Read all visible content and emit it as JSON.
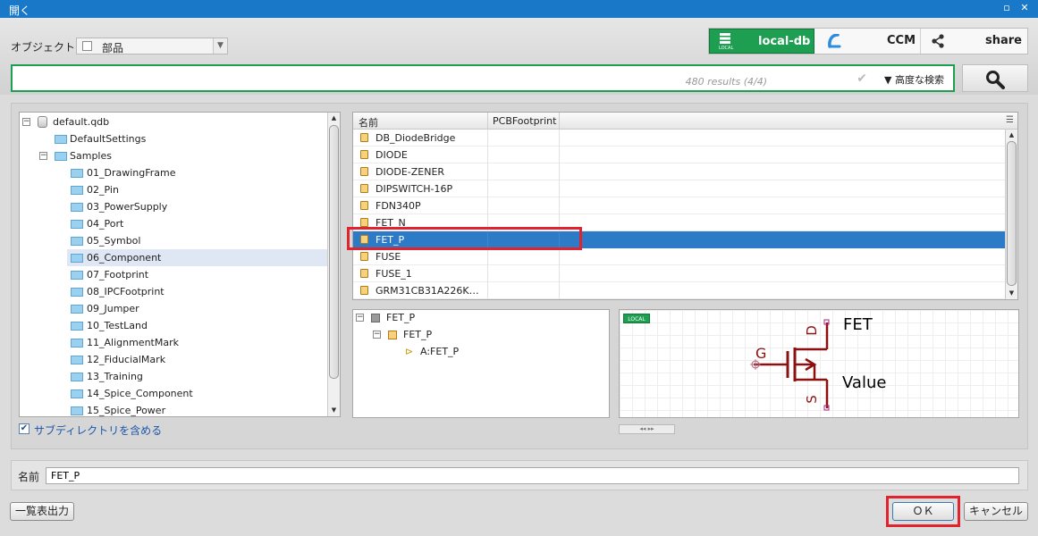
{
  "window": {
    "title": "開く",
    "buttons": [
      "▫",
      "✕"
    ]
  },
  "object": {
    "label": "オブジェクト",
    "selected": "部品"
  },
  "databases": [
    {
      "label": "local-db",
      "icon": "local-db-icon",
      "badge": "LOCAL",
      "active": true
    },
    {
      "label": "CCM",
      "icon": "ccm-cloud-icon",
      "active": false
    },
    {
      "label": "share",
      "icon": "share-icon",
      "active": false
    }
  ],
  "search": {
    "value": "",
    "results": "480 results (4/4)",
    "advanced": "▼ 高度な検索",
    "check": "✔"
  },
  "tree": {
    "root": "default.qdb",
    "items": [
      {
        "label": "DefaultSettings",
        "level": 1
      },
      {
        "label": "Samples",
        "level": 1,
        "expanded": true
      },
      {
        "label": "01_DrawingFrame",
        "level": 2
      },
      {
        "label": "02_Pin",
        "level": 2
      },
      {
        "label": "03_PowerSupply",
        "level": 2
      },
      {
        "label": "04_Port",
        "level": 2
      },
      {
        "label": "05_Symbol",
        "level": 2
      },
      {
        "label": "06_Component",
        "level": 2,
        "selected": true
      },
      {
        "label": "07_Footprint",
        "level": 2
      },
      {
        "label": "08_IPCFootprint",
        "level": 2
      },
      {
        "label": "09_Jumper",
        "level": 2
      },
      {
        "label": "10_TestLand",
        "level": 2
      },
      {
        "label": "11_AlignmentMark",
        "level": 2
      },
      {
        "label": "12_FiducialMark",
        "level": 2
      },
      {
        "label": "13_Training",
        "level": 2
      },
      {
        "label": "14_Spice_Component",
        "level": 2
      },
      {
        "label": "15_Spice_Power",
        "level": 2
      }
    ]
  },
  "include_subdirs": {
    "label": "サブディレクトリを含める",
    "checked": true
  },
  "list": {
    "columns": [
      "名前",
      "PCBFootprint"
    ],
    "rows": [
      "DB_DiodeBridge",
      "DIODE",
      "DIODE-ZENER",
      "DIPSWITCH-16P",
      "FDN340P",
      "FET_N",
      "FET_P",
      "FUSE",
      "FUSE_1",
      "GRM31CB31A226K…"
    ],
    "selected": "FET_P"
  },
  "parts_tree": {
    "items": [
      "FET_P",
      "FET_P",
      "A:FET_P"
    ]
  },
  "preview": {
    "badge": "LOCAL",
    "pins": {
      "gate": "G",
      "drain": "D",
      "source": "S"
    },
    "refdes": "FET",
    "value": "Value",
    "scroll_arrows": "◂◂ ▸▸"
  },
  "name": {
    "label": "名前",
    "value": "FET_P"
  },
  "buttons": {
    "export": "一覧表出力",
    "ok": "ＯＫ",
    "cancel": "キャンセル"
  },
  "colors": {
    "accent_green": "#1e9e50",
    "selection_blue": "#2d7bc6",
    "highlight_red": "#e0232c",
    "symbol_red": "#8b1010"
  }
}
